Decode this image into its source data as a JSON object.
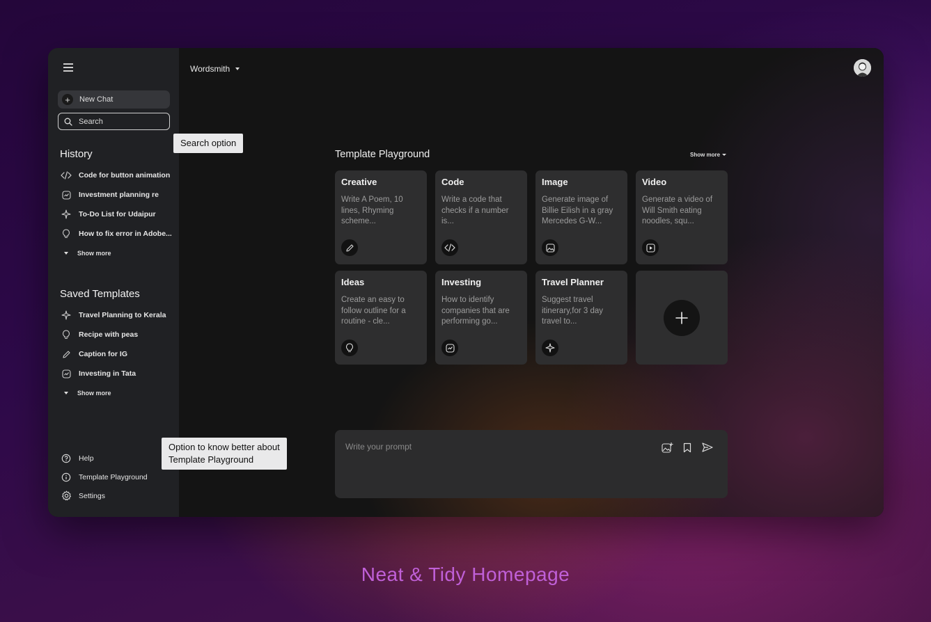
{
  "sidebar": {
    "new_chat_label": "New Chat",
    "search_label": "Search",
    "history_title": "History",
    "history_items": [
      {
        "label": "Code for button animation",
        "icon": "code-icon"
      },
      {
        "label": "Investment planning re",
        "icon": "chart-icon"
      },
      {
        "label": "To-Do List for Udaipur",
        "icon": "plane-icon"
      },
      {
        "label": "How to fix error in Adobe...",
        "icon": "bulb-icon"
      }
    ],
    "history_show_more": "Show more",
    "saved_title": "Saved Templates",
    "saved_items": [
      {
        "label": "Travel Planning to Kerala",
        "icon": "plane-icon"
      },
      {
        "label": "Recipe with peas",
        "icon": "bulb-icon"
      },
      {
        "label": "Caption for IG",
        "icon": "pencil-icon"
      },
      {
        "label": "Investing in Tata",
        "icon": "chart-icon"
      }
    ],
    "saved_show_more": "Show more",
    "bottom_items": [
      {
        "label": "Help",
        "icon": "help-icon"
      },
      {
        "label": "Template Playground",
        "icon": "info-icon"
      },
      {
        "label": "Settings",
        "icon": "gear-icon"
      }
    ]
  },
  "topbar": {
    "app_name": "Wordsmith"
  },
  "playground": {
    "title": "Template Playground",
    "show_more": "Show more",
    "cards": [
      {
        "title": "Creative",
        "desc": "Write A Poem, 10 lines, Rhyming scheme...",
        "icon": "pencil-icon"
      },
      {
        "title": "Code",
        "desc": "Write a code that checks if a number is...",
        "icon": "code-icon"
      },
      {
        "title": "Image",
        "desc": "Generate image of Billie Eilish in a gray Mercedes G-W...",
        "icon": "image-icon"
      },
      {
        "title": "Video",
        "desc": "Generate a video of Will Smith eating noodles, squ...",
        "icon": "video-icon"
      },
      {
        "title": "Ideas",
        "desc": "Create an easy to follow outline for a routine - cle...",
        "icon": "bulb-icon"
      },
      {
        "title": "Investing",
        "desc": "How to identify companies that are performing go...",
        "icon": "chart-icon"
      },
      {
        "title": "Travel Planner",
        "desc": "Suggest travel itinerary,for 3 day travel to...",
        "icon": "plane-icon"
      }
    ]
  },
  "prompt": {
    "placeholder": "Write your prompt"
  },
  "callouts": {
    "search": "Search option",
    "playground_line1": "Option to know better about",
    "playground_line2": "Template Playground"
  },
  "caption": "Neat & Tidy Homepage"
}
